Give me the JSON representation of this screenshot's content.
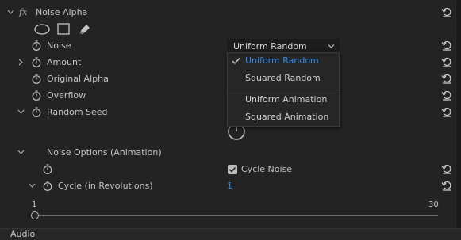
{
  "effect": {
    "name": "Noise Alpha",
    "fx_label": "fx",
    "shape_tools": [
      "ellipse-mask-icon",
      "rectangle-mask-icon",
      "pen-mask-icon"
    ]
  },
  "properties": {
    "noise": "Noise",
    "amount": "Amount",
    "original_alpha": "Original Alpha",
    "overflow": "Overflow",
    "random_seed": "Random Seed",
    "noise_options": "Noise Options (Animation)",
    "cycle": "Cycle (in Revolutions)"
  },
  "noise_dropdown": {
    "selected": "Uniform Random",
    "options": [
      "Uniform Random",
      "Squared Random",
      "Uniform Animation",
      "Squared Animation"
    ],
    "checked_index": 0,
    "highlight_color": "#2d8ceb"
  },
  "cycle_noise": {
    "label": "Cycle Noise",
    "checked": true
  },
  "cycle_value": "1",
  "cycle_slider": {
    "min_label": "1",
    "max_label": "30",
    "value": 1
  },
  "footer": {
    "label": "Audio"
  },
  "colors": {
    "background": "#232323",
    "text": "#c4c4c4",
    "value_blue": "#2d8ceb"
  }
}
